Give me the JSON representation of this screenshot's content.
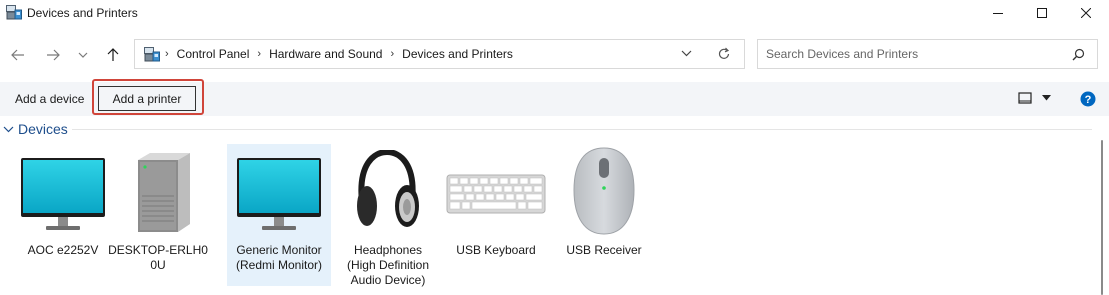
{
  "window": {
    "title": "Devices and Printers",
    "controls": {
      "minimize_icon": "minimize-icon",
      "maximize_icon": "maximize-icon",
      "close_icon": "close-icon"
    }
  },
  "nav": {
    "back_icon": "arrow-left-icon",
    "forward_icon": "arrow-right-icon",
    "recent_icon": "chevron-down-icon",
    "up_icon": "arrow-up-icon"
  },
  "address": {
    "icon": "devices-and-printers-icon",
    "breadcrumbs": [
      "Control Panel",
      "Hardware and Sound",
      "Devices and Printers"
    ],
    "dropdown_icon": "chevron-down-icon",
    "refresh_icon": "refresh-icon"
  },
  "search": {
    "placeholder": "Search Devices and Printers",
    "value": "",
    "icon": "search-icon"
  },
  "toolbar": {
    "add_device": "Add a device",
    "add_printer": "Add a printer",
    "view_icon": "view-options-icon",
    "help_icon": "help-icon",
    "highlight_color": "#d0453a"
  },
  "devices_group": {
    "title": "Devices",
    "items": [
      {
        "line1": "AOC e2252V",
        "line2": "",
        "line3": "",
        "icon": "monitor-icon",
        "selected": false
      },
      {
        "line1": "DESKTOP-ERLH0",
        "line2": "0U",
        "line3": "",
        "icon": "computer-tower-icon",
        "selected": false
      },
      {
        "line1": "Generic Monitor",
        "line2": "(Redmi Monitor)",
        "line3": "",
        "icon": "monitor-icon",
        "selected": true
      },
      {
        "line1": "Headphones",
        "line2": "(High Definition",
        "line3": "Audio Device)",
        "icon": "headphones-icon",
        "selected": false
      },
      {
        "line1": "USB Keyboard",
        "line2": "",
        "line3": "",
        "icon": "keyboard-icon",
        "selected": false
      },
      {
        "line1": "USB Receiver",
        "line2": "",
        "line3": "",
        "icon": "mouse-icon",
        "selected": false
      }
    ]
  },
  "colors": {
    "accent": "#0067c0",
    "group_title": "#1e4e8c",
    "selection": "#e5f1fb",
    "toolbar_bg": "#f3f5f8"
  }
}
